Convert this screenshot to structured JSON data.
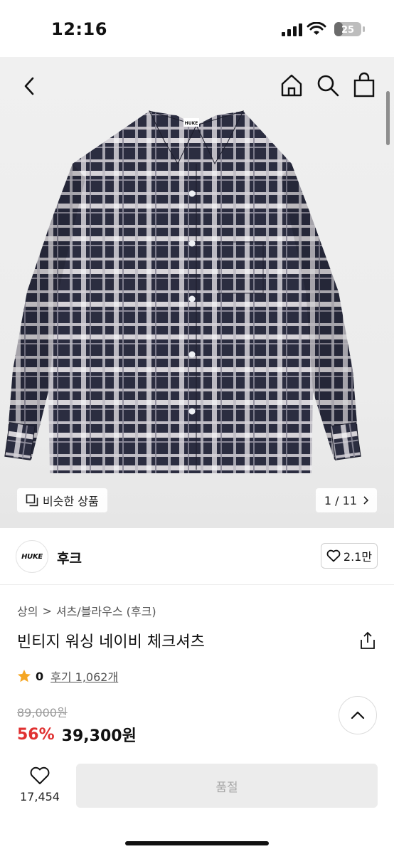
{
  "status_bar": {
    "time": "12:16",
    "battery": "25"
  },
  "nav": {
    "back_icon": "chevron-left-icon",
    "home_icon": "home-icon",
    "search_icon": "search-icon",
    "cart_icon": "shopping-bag-icon"
  },
  "hero": {
    "image_label": "HUKE",
    "similar_label": "비슷한 상품",
    "counter": "1 / 11",
    "colors": {
      "plaid_dark": "#2b2d40",
      "plaid_light": "#cfcbd0"
    }
  },
  "brand": {
    "logo_text": "HUKE",
    "name": "후크",
    "like_count": "2.1만"
  },
  "breadcrumb": {
    "category": "상의",
    "separator": ">",
    "subcategory": "셔츠/블라우스 (후크)"
  },
  "product": {
    "title": "빈티지 워싱 네이비 체크셔츠",
    "rating": "0",
    "review_label": "후기 1,062개",
    "original_price": "89,000원",
    "discount": "56%",
    "price": "39,300원"
  },
  "bottom": {
    "like_count": "17,454",
    "buy_label": "품절"
  },
  "colors": {
    "discount_red": "#e03131",
    "star": "#f5a623",
    "soldout_bg": "#ececec"
  }
}
